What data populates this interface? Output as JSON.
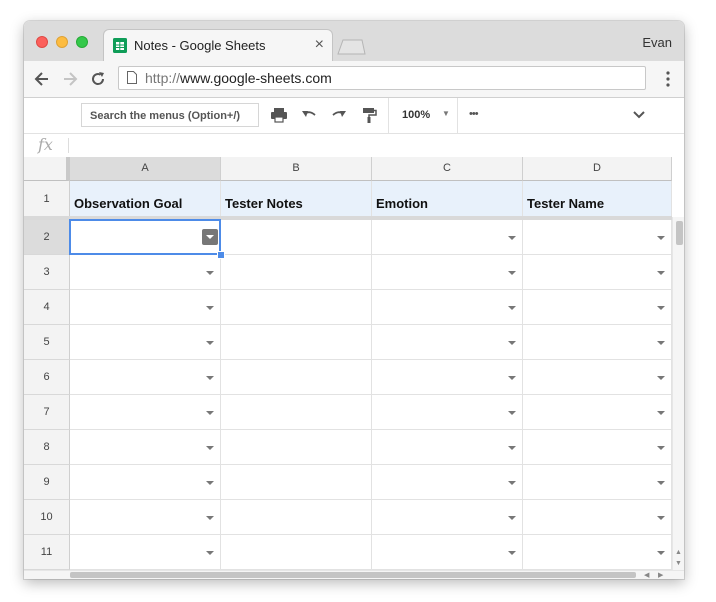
{
  "window": {
    "tab_title": "Notes - Google Sheets",
    "profile_name": "Evan",
    "url_protocol": "http://",
    "url_host": "www.google-sheets.com"
  },
  "toolbar": {
    "search_placeholder": "Search the menus (Option+/)",
    "zoom": "100%",
    "more": "•••"
  },
  "formula_bar": {
    "fx_label": "fx",
    "value": ""
  },
  "columns": [
    {
      "letter": "A",
      "header": "Observation Goal"
    },
    {
      "letter": "B",
      "header": "Tester Notes"
    },
    {
      "letter": "C",
      "header": "Emotion"
    },
    {
      "letter": "D",
      "header": "Tester Name"
    }
  ],
  "rows": [
    "1",
    "2",
    "3",
    "4",
    "5",
    "6",
    "7",
    "8",
    "9",
    "10",
    "11"
  ],
  "selected_cell": "A2",
  "colors": {
    "header_fill": "#e8f1fb",
    "selection": "#4d8be8",
    "sheets_green": "#0f9d58"
  }
}
